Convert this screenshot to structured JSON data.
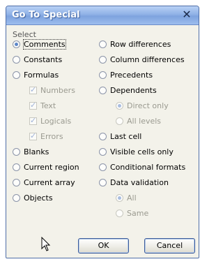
{
  "dialog": {
    "title": "Go To Special",
    "close_label": "✕",
    "group_label": "Select"
  },
  "left_options": [
    {
      "label": "Comments",
      "type": "radio",
      "selected": true,
      "enabled": true
    },
    {
      "label": "Constants",
      "type": "radio",
      "selected": false,
      "enabled": true
    },
    {
      "label": "Formulas",
      "type": "radio",
      "selected": false,
      "enabled": true
    },
    {
      "label": "Numbers",
      "type": "checkbox",
      "checked": true,
      "enabled": false
    },
    {
      "label": "Text",
      "type": "checkbox",
      "checked": true,
      "enabled": false
    },
    {
      "label": "Logicals",
      "type": "checkbox",
      "checked": true,
      "enabled": false
    },
    {
      "label": "Errors",
      "type": "checkbox",
      "checked": true,
      "enabled": false
    },
    {
      "label": "Blanks",
      "type": "radio",
      "selected": false,
      "enabled": true
    },
    {
      "label": "Current region",
      "type": "radio",
      "selected": false,
      "enabled": true
    },
    {
      "label": "Current array",
      "type": "radio",
      "selected": false,
      "enabled": true
    },
    {
      "label": "Objects",
      "type": "radio",
      "selected": false,
      "enabled": true
    }
  ],
  "right_options": [
    {
      "label": "Row differences",
      "type": "radio",
      "selected": false,
      "enabled": true
    },
    {
      "label": "Column differences",
      "type": "radio",
      "selected": false,
      "enabled": true
    },
    {
      "label": "Precedents",
      "type": "radio",
      "selected": false,
      "enabled": true
    },
    {
      "label": "Dependents",
      "type": "radio",
      "selected": false,
      "enabled": true
    },
    {
      "label": "Direct only",
      "type": "radio",
      "selected": true,
      "enabled": false
    },
    {
      "label": "All levels",
      "type": "radio",
      "selected": false,
      "enabled": false
    },
    {
      "label": "Last cell",
      "type": "radio",
      "selected": false,
      "enabled": true
    },
    {
      "label": "Visible cells only",
      "type": "radio",
      "selected": false,
      "enabled": true
    },
    {
      "label": "Conditional formats",
      "type": "radio",
      "selected": false,
      "enabled": true
    },
    {
      "label": "Data validation",
      "type": "radio",
      "selected": false,
      "enabled": true
    },
    {
      "label": "All",
      "type": "radio",
      "selected": true,
      "enabled": false
    },
    {
      "label": "Same",
      "type": "radio",
      "selected": false,
      "enabled": false
    }
  ],
  "buttons": {
    "ok": "OK",
    "cancel": "Cancel"
  },
  "colors": {
    "titlebar": "#8fb1e6",
    "dialog_bg": "#f3f2ea",
    "accent": "#5b86c8"
  }
}
